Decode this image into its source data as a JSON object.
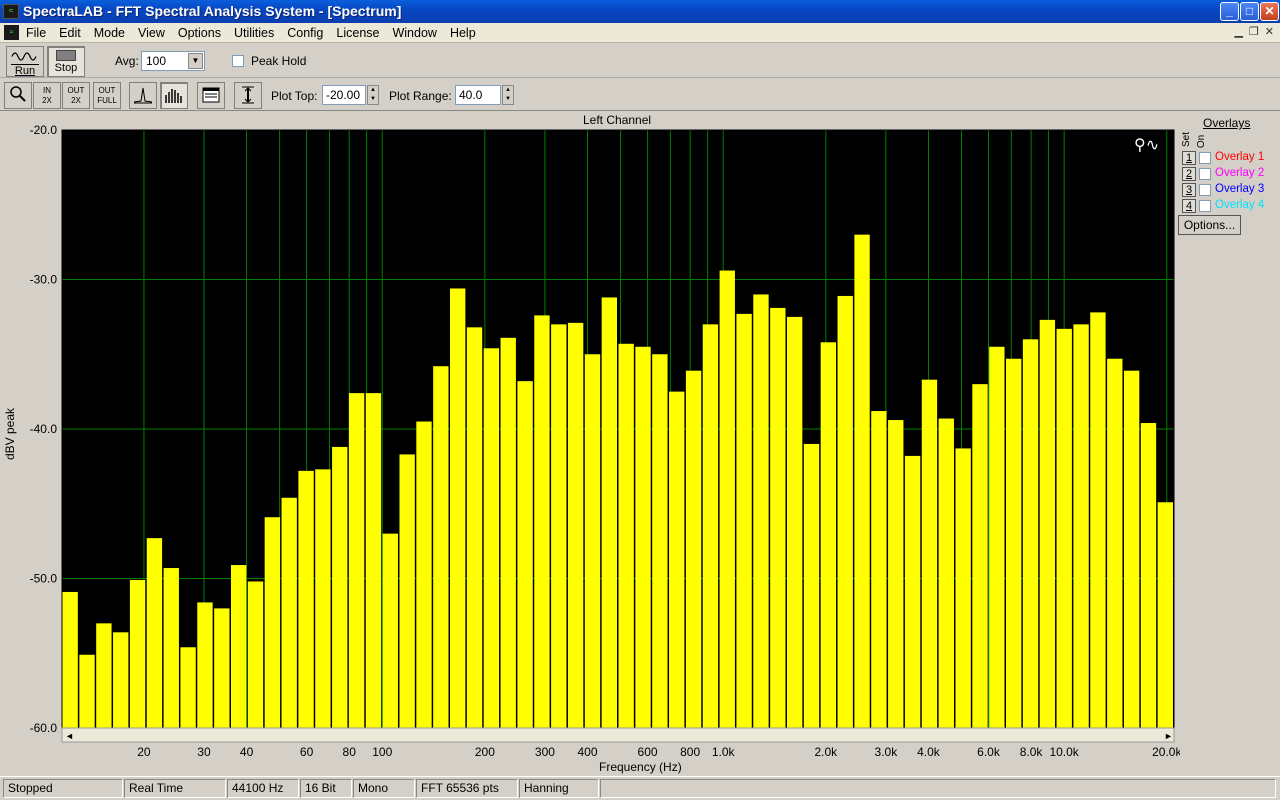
{
  "window": {
    "title": "SpectraLAB - FFT Spectral Analysis System - [Spectrum]",
    "minimize": "_",
    "maximize": "□",
    "close": "✕"
  },
  "menu": {
    "items": [
      "File",
      "Edit",
      "Mode",
      "View",
      "Options",
      "Utilities",
      "Config",
      "License",
      "Window",
      "Help"
    ]
  },
  "toolbar1": {
    "run_label": "Run",
    "stop_label": "Stop",
    "avg_label": "Avg:",
    "avg_value": "100",
    "peak_hold_label": "Peak Hold",
    "peak_hold_checked": false
  },
  "toolbar2": {
    "zoom_in_label": "IN\n2X",
    "zoom_out2x_label": "OUT\n2X",
    "zoom_full_label": "OUT\nFULL",
    "plot_top_label": "Plot Top:",
    "plot_top_value": "-20.00",
    "plot_range_label": "Plot Range:",
    "plot_range_value": "40.0"
  },
  "overlays": {
    "title": "Overlays",
    "set_label": "Set",
    "on_label": "On",
    "items": [
      {
        "num": "1",
        "label": "Overlay 1",
        "color": "#ff0000"
      },
      {
        "num": "2",
        "label": "Overlay 2",
        "color": "#ff00ff"
      },
      {
        "num": "3",
        "label": "Overlay 3",
        "color": "#0000ff"
      },
      {
        "num": "4",
        "label": "Overlay 4",
        "color": "#00e0ff"
      }
    ],
    "options_label": "Options..."
  },
  "chart_data": {
    "type": "bar",
    "title": "Left Channel",
    "xlabel": "Frequency (Hz)",
    "ylabel": "dBV peak",
    "x_scale": "log",
    "xlim": [
      11.5,
      21000
    ],
    "ylim": [
      -60,
      -20
    ],
    "y_ticks": [
      "-20.0",
      "-30.0",
      "-40.0",
      "-50.0",
      "-60.0"
    ],
    "y_tick_values": [
      -20,
      -30,
      -40,
      -50,
      -60
    ],
    "x_tick_labels": [
      "20",
      "30",
      "40",
      "60",
      "80",
      "100",
      "200",
      "300",
      "400",
      "600",
      "800",
      "1.0k",
      "2.0k",
      "3.0k",
      "4.0k",
      "6.0k",
      "8.0k",
      "10.0k",
      "20.0k"
    ],
    "x_tick_values": [
      20,
      30,
      40,
      60,
      80,
      100,
      200,
      300,
      400,
      600,
      800,
      1000,
      2000,
      3000,
      4000,
      6000,
      8000,
      10000,
      20000
    ],
    "grid": true,
    "background": "#000000",
    "bar_color": "#ffff00",
    "grid_color": "#008000",
    "values": [
      -50.9,
      -55.1,
      -53.0,
      -53.6,
      -50.1,
      -47.3,
      -49.3,
      -54.6,
      -51.6,
      -52.0,
      -49.1,
      -50.2,
      -45.9,
      -44.6,
      -42.8,
      -42.7,
      -41.2,
      -37.6,
      -37.6,
      -47.0,
      -41.7,
      -39.5,
      -35.8,
      -30.6,
      -33.2,
      -34.6,
      -33.9,
      -36.8,
      -32.4,
      -33.0,
      -32.9,
      -35.0,
      -31.2,
      -34.3,
      -34.5,
      -35.0,
      -37.5,
      -36.1,
      -33.0,
      -29.4,
      -32.3,
      -31.0,
      -31.9,
      -32.5,
      -41.0,
      -34.2,
      -31.1,
      -27.0,
      -38.8,
      -39.4,
      -41.8,
      -36.7,
      -39.3,
      -41.3,
      -37.0,
      -34.5,
      -35.3,
      -34.0,
      -32.7,
      -33.3,
      -33.0,
      -32.2,
      -35.3,
      -36.1,
      -39.6,
      -44.9
    ]
  },
  "statusbar": {
    "state": "Stopped",
    "mode": "Real Time",
    "rate": "44100 Hz",
    "bits": "16 Bit",
    "channels": "Mono",
    "fft": "FFT 65536 pts",
    "window_fn": "Hanning"
  }
}
